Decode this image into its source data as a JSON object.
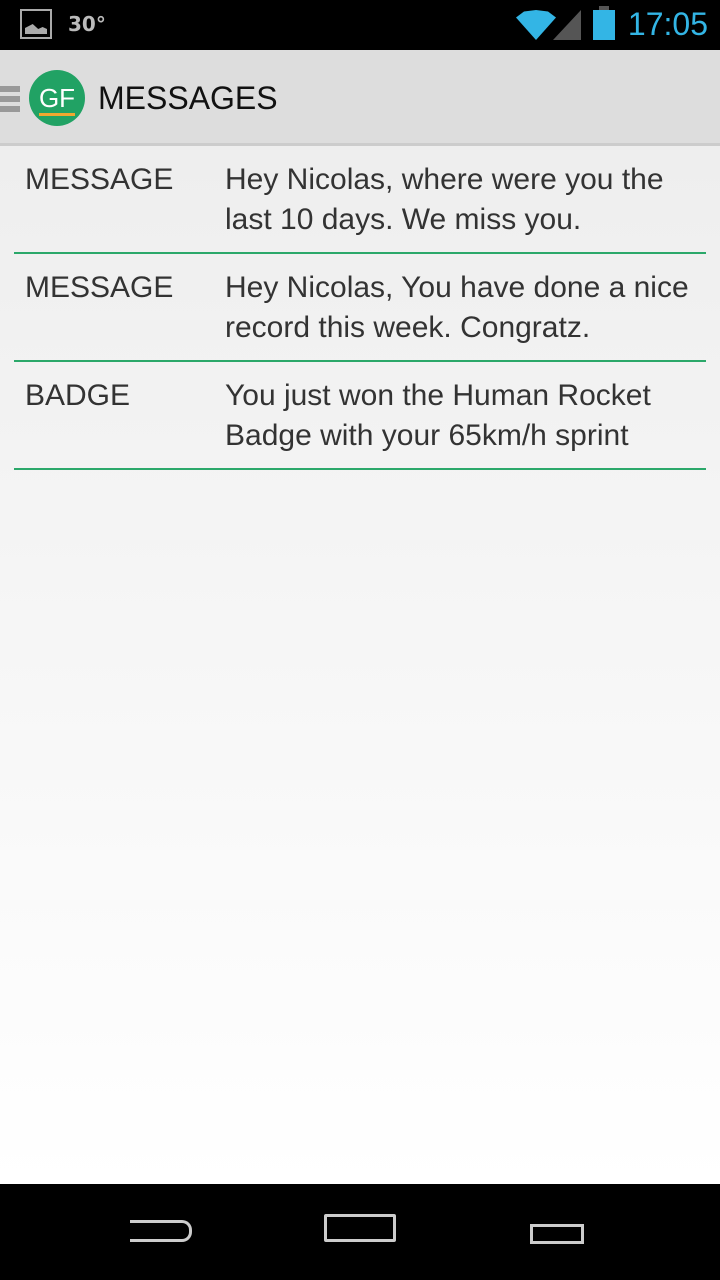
{
  "status": {
    "temperature": "30°",
    "time": "17:05"
  },
  "actionbar": {
    "logo": "GF",
    "title": "MESSAGES"
  },
  "messages": [
    {
      "type": "MESSAGE",
      "text": "Hey Nicolas, where were you the last 10 days. We miss you."
    },
    {
      "type": "MESSAGE",
      "text": "Hey Nicolas, You have done a nice record this week. Congratz."
    },
    {
      "type": "BADGE",
      "text": "You just won the Human Rocket Badge with your 65km/h sprint"
    }
  ]
}
